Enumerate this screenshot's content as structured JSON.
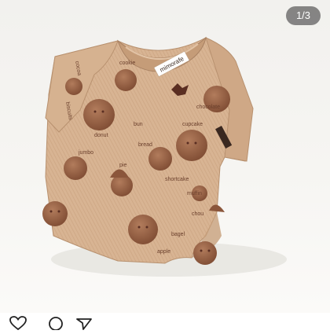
{
  "image_counter": "1/3",
  "product_photo": {
    "brand_tag": "mimorafe",
    "print_words": [
      "cocoa",
      "biscuits",
      "cookie",
      "donut",
      "jumbo",
      "bun",
      "bread",
      "pie",
      "shortcake",
      "cupcake",
      "muffin",
      "chocolate",
      "bagel",
      "chou",
      "apple"
    ]
  },
  "actions": [
    {
      "name": "like-icon"
    },
    {
      "name": "comment-icon"
    },
    {
      "name": "share-icon"
    }
  ],
  "colors": {
    "fabric": "#d9b594",
    "fabric_dark": "#c79f7b",
    "print_brown": "#8e5a3f",
    "counter_bg": "#5a5a5a"
  }
}
